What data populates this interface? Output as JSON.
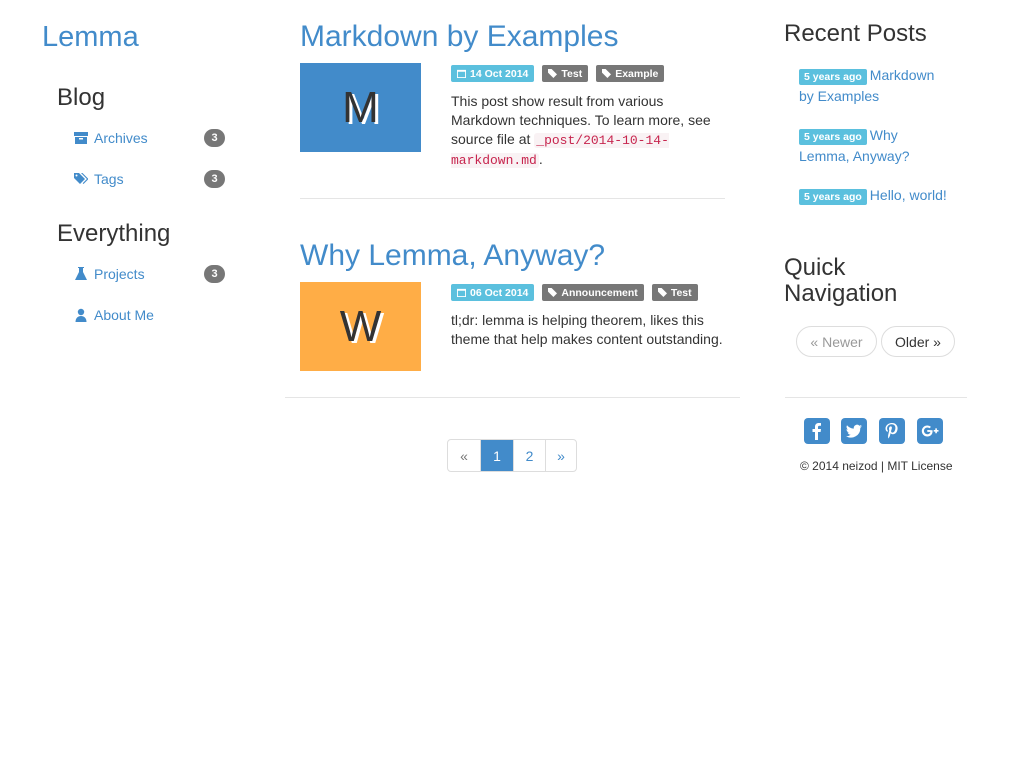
{
  "site": {
    "brand": "Lemma"
  },
  "sidebar": {
    "blog_heading": "Blog",
    "blog_items": [
      {
        "label": "Archives",
        "count": "3",
        "icon": "archive-icon"
      },
      {
        "label": "Tags",
        "count": "3",
        "icon": "tags-icon"
      }
    ],
    "everything_heading": "Everything",
    "everything_items": [
      {
        "label": "Projects",
        "count": "3",
        "icon": "flask-icon"
      },
      {
        "label": "About Me",
        "icon": "user-icon"
      }
    ]
  },
  "posts": [
    {
      "title": "Markdown by Examples",
      "thumb_letter": "M",
      "thumb_color": "#428bca",
      "date": "14 Oct 2014",
      "tags": [
        "Test",
        "Example"
      ],
      "excerpt_before": "This post show result from various Markdown techniques. To learn more, see source file at ",
      "excerpt_code": "_post/2014-10-14-markdown.md",
      "excerpt_after": "."
    },
    {
      "title": "Why Lemma, Anyway?",
      "thumb_letter": "W",
      "thumb_color": "#ffad46",
      "date": "06 Oct 2014",
      "tags": [
        "Announcement",
        "Test"
      ],
      "excerpt_before": "tl;dr: lemma is helping theorem, likes this theme that help makes content outstanding.",
      "excerpt_code": "",
      "excerpt_after": ""
    }
  ],
  "pagination": {
    "prev": "«",
    "pages": [
      "1",
      "2"
    ],
    "current": "1",
    "next": "»"
  },
  "right": {
    "recent_heading": "Recent Posts",
    "recent": [
      {
        "ago": "5 years ago",
        "title": "Markdown by Examples"
      },
      {
        "ago": "5 years ago",
        "title": "Why Lemma, Anyway?"
      },
      {
        "ago": "5 years ago",
        "title": "Hello, world!"
      }
    ],
    "quicknav_heading": "Quick Navigation",
    "newer_label": "« Newer",
    "older_label": "Older »",
    "social": [
      "facebook-icon",
      "twitter-icon",
      "pinterest-icon",
      "google-plus-icon"
    ],
    "footer": "© 2014 neizod | MIT License"
  },
  "colors": {
    "accent": "#428bca",
    "info": "#5bc0de",
    "muted": "#777777",
    "orange": "#ffad46"
  }
}
